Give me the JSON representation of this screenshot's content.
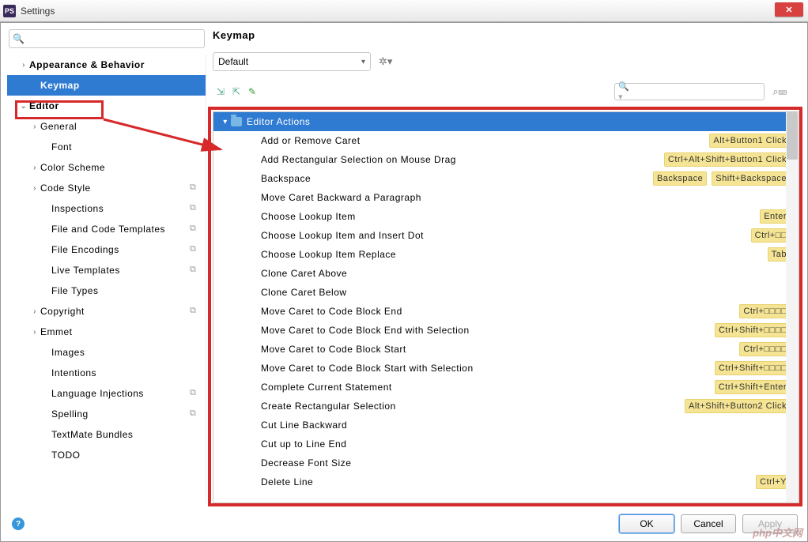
{
  "window": {
    "title": "Settings"
  },
  "sidebar": {
    "search_placeholder": "",
    "items": [
      {
        "label": "Appearance & Behavior",
        "indent": 1,
        "chev": ">",
        "bold": true
      },
      {
        "label": "Keymap",
        "indent": 2,
        "chev": "",
        "bold": true,
        "selected": true
      },
      {
        "label": "Editor",
        "indent": 1,
        "chev": "v",
        "bold": true
      },
      {
        "label": "General",
        "indent": 2,
        "chev": ">"
      },
      {
        "label": "Font",
        "indent": 3,
        "chev": ""
      },
      {
        "label": "Color Scheme",
        "indent": 2,
        "chev": ">"
      },
      {
        "label": "Code Style",
        "indent": 2,
        "chev": ">",
        "icon": true
      },
      {
        "label": "Inspections",
        "indent": 3,
        "chev": "",
        "icon": true
      },
      {
        "label": "File and Code Templates",
        "indent": 3,
        "chev": "",
        "icon": true
      },
      {
        "label": "File Encodings",
        "indent": 3,
        "chev": "",
        "icon": true
      },
      {
        "label": "Live Templates",
        "indent": 3,
        "chev": "",
        "icon": true
      },
      {
        "label": "File Types",
        "indent": 3,
        "chev": ""
      },
      {
        "label": "Copyright",
        "indent": 2,
        "chev": ">",
        "icon": true
      },
      {
        "label": "Emmet",
        "indent": 2,
        "chev": ">"
      },
      {
        "label": "Images",
        "indent": 3,
        "chev": ""
      },
      {
        "label": "Intentions",
        "indent": 3,
        "chev": ""
      },
      {
        "label": "Language Injections",
        "indent": 3,
        "chev": "",
        "icon": true
      },
      {
        "label": "Spelling",
        "indent": 3,
        "chev": "",
        "icon": true
      },
      {
        "label": "TextMate Bundles",
        "indent": 3,
        "chev": ""
      },
      {
        "label": "TODO",
        "indent": 3,
        "chev": ""
      }
    ]
  },
  "content": {
    "title": "Keymap",
    "scheme": "Default",
    "group": "Editor Actions",
    "actions": [
      {
        "name": "Add or Remove Caret",
        "sc": [
          "Alt+Button1 Click"
        ]
      },
      {
        "name": "Add Rectangular Selection on Mouse Drag",
        "sc": [
          "Ctrl+Alt+Shift+Button1 Click"
        ]
      },
      {
        "name": "Backspace",
        "sc": [
          "Backspace",
          "Shift+Backspace"
        ]
      },
      {
        "name": "Move Caret Backward a Paragraph",
        "sc": []
      },
      {
        "name": "Choose Lookup Item",
        "sc": [
          "Enter"
        ]
      },
      {
        "name": "Choose Lookup Item and Insert Dot",
        "sc": [
          "Ctrl+□□"
        ]
      },
      {
        "name": "Choose Lookup Item Replace",
        "sc": [
          "Tab"
        ]
      },
      {
        "name": "Clone Caret Above",
        "sc": []
      },
      {
        "name": "Clone Caret Below",
        "sc": []
      },
      {
        "name": "Move Caret to Code Block End",
        "sc": [
          "Ctrl+□□□□"
        ]
      },
      {
        "name": "Move Caret to Code Block End with Selection",
        "sc": [
          "Ctrl+Shift+□□□□"
        ]
      },
      {
        "name": "Move Caret to Code Block Start",
        "sc": [
          "Ctrl+□□□□"
        ]
      },
      {
        "name": "Move Caret to Code Block Start with Selection",
        "sc": [
          "Ctrl+Shift+□□□□"
        ]
      },
      {
        "name": "Complete Current Statement",
        "sc": [
          "Ctrl+Shift+Enter"
        ]
      },
      {
        "name": "Create Rectangular Selection",
        "sc": [
          "Alt+Shift+Button2 Click"
        ]
      },
      {
        "name": "Cut Line Backward",
        "sc": []
      },
      {
        "name": "Cut up to Line End",
        "sc": []
      },
      {
        "name": "Decrease Font Size",
        "sc": []
      },
      {
        "name": "Delete Line",
        "sc": [
          "Ctrl+Y"
        ]
      }
    ]
  },
  "buttons": {
    "ok": "OK",
    "cancel": "Cancel",
    "apply": "Apply"
  },
  "watermark": "php中文网"
}
